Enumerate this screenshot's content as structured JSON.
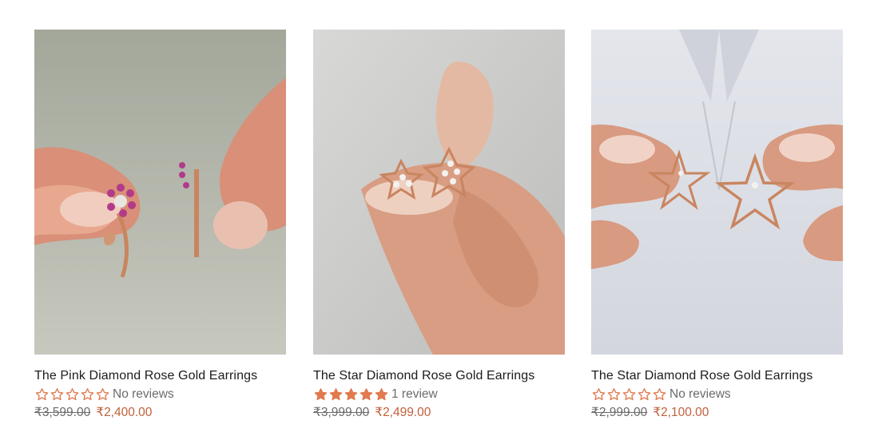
{
  "colors": {
    "accent": "#c0603b",
    "star": "#e07a4f",
    "muted": "#6b6b6b"
  },
  "products": [
    {
      "title": "The Pink Diamond Rose Gold Earrings",
      "image_alt": "rose gold flower earring with pink stones",
      "rating": 0,
      "review_text": "No reviews",
      "old_price": "₹3,599.00",
      "new_price": "₹2,400.00"
    },
    {
      "title": "The Star Diamond Rose Gold Earrings",
      "image_alt": "rose gold star earrings with diamonds",
      "rating": 5,
      "review_text": "1 review",
      "old_price": "₹3,999.00",
      "new_price": "₹2,499.00"
    },
    {
      "title": "The Star Diamond Rose Gold Earrings",
      "image_alt": "rose gold open star earrings",
      "rating": 0,
      "review_text": "No reviews",
      "old_price": "₹2,999.00",
      "new_price": "₹2,100.00"
    }
  ]
}
